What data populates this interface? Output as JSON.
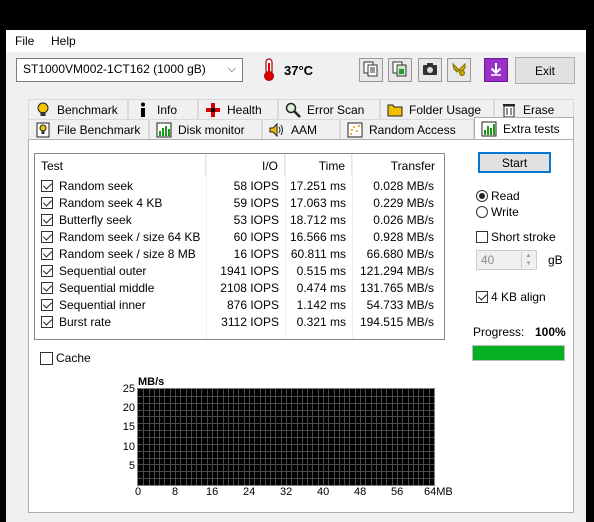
{
  "menu": {
    "file": "File",
    "help": "Help"
  },
  "toolbar": {
    "drive": "ST1000VM002-1CT162 (1000 gB)",
    "temperature": "37°C",
    "exit_label": "Exit",
    "icons": [
      "copy-text-icon",
      "copy-image-icon",
      "camera-icon",
      "options-icon",
      "download-icon"
    ]
  },
  "tabs": {
    "row1": [
      {
        "label": "Benchmark",
        "icon": "lightbulb-icon"
      },
      {
        "label": "Info",
        "icon": "info-icon"
      },
      {
        "label": "Health",
        "icon": "health-icon"
      },
      {
        "label": "Error Scan",
        "icon": "magnifier-icon"
      },
      {
        "label": "Folder Usage",
        "icon": "folder-icon"
      },
      {
        "label": "Erase",
        "icon": "trash-icon"
      }
    ],
    "row2": [
      {
        "label": "File Benchmark",
        "icon": "file-benchmark-icon"
      },
      {
        "label": "Disk monitor",
        "icon": "disk-monitor-icon"
      },
      {
        "label": "AAM",
        "icon": "speaker-icon"
      },
      {
        "label": "Random Access",
        "icon": "random-access-icon"
      },
      {
        "label": "Extra tests",
        "icon": "extra-tests-icon"
      }
    ],
    "active": "Extra tests"
  },
  "table": {
    "headers": {
      "test": "Test",
      "io": "I/O",
      "time": "Time",
      "transfer": "Transfer"
    },
    "rows": [
      {
        "test": "Random seek",
        "io": "58 IOPS",
        "time": "17.251 ms",
        "transfer": "0.028 MB/s",
        "checked": true
      },
      {
        "test": "Random seek 4 KB",
        "io": "59 IOPS",
        "time": "17.063 ms",
        "transfer": "0.229 MB/s",
        "checked": true
      },
      {
        "test": "Butterfly seek",
        "io": "53 IOPS",
        "time": "18.712 ms",
        "transfer": "0.026 MB/s",
        "checked": true
      },
      {
        "test": "Random seek / size 64 KB",
        "io": "60 IOPS",
        "time": "16.566 ms",
        "transfer": "0.928 MB/s",
        "checked": true
      },
      {
        "test": "Random seek / size 8 MB",
        "io": "16 IOPS",
        "time": "60.811 ms",
        "transfer": "66.680 MB/s",
        "checked": true
      },
      {
        "test": "Sequential outer",
        "io": "1941 IOPS",
        "time": "0.515 ms",
        "transfer": "121.294 MB/s",
        "checked": true
      },
      {
        "test": "Sequential middle",
        "io": "2108 IOPS",
        "time": "0.474 ms",
        "transfer": "131.765 MB/s",
        "checked": true
      },
      {
        "test": "Sequential inner",
        "io": "876 IOPS",
        "time": "1.142 ms",
        "transfer": "54.733 MB/s",
        "checked": true
      },
      {
        "test": "Burst rate",
        "io": "3112 IOPS",
        "time": "0.321 ms",
        "transfer": "194.515 MB/s",
        "checked": true
      }
    ]
  },
  "cache": {
    "label": "Cache",
    "checked": false
  },
  "controls": {
    "start_label": "Start",
    "read_label": "Read",
    "write_label": "Write",
    "mode": "Read",
    "short_stroke_label": "Short stroke",
    "short_stroke_checked": false,
    "short_stroke_value": "40",
    "short_stroke_unit": "gB",
    "align_label": "4 KB align",
    "align_checked": true
  },
  "progress": {
    "label": "Progress:",
    "value_text": "100%",
    "fraction": 1.0,
    "color": "#06b025"
  },
  "chart_data": {
    "type": "line",
    "ylabel": "MB/s",
    "xlabel": "",
    "y_ticks": [
      "25",
      "20",
      "15",
      "10",
      "5"
    ],
    "x_ticks": [
      "0",
      "8",
      "16",
      "24",
      "32",
      "40",
      "48",
      "56",
      "64MB"
    ],
    "ylim": [
      0,
      25
    ],
    "xlim": [
      0,
      64
    ],
    "grid": true,
    "series": []
  }
}
